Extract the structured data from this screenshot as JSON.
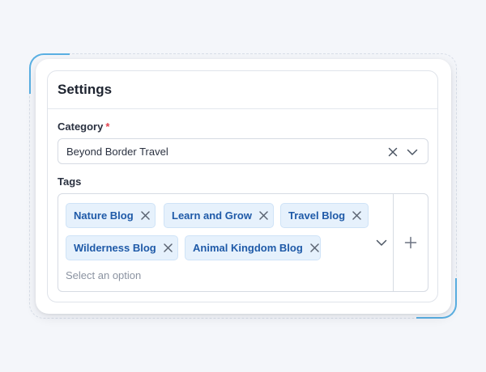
{
  "settings": {
    "title": "Settings",
    "category": {
      "label": "Category",
      "required_mark": "*",
      "value": "Beyond Border Travel"
    },
    "tags": {
      "label": "Tags",
      "items": [
        {
          "label": "Nature Blog"
        },
        {
          "label": "Learn and Grow"
        },
        {
          "label": "Travel Blog"
        },
        {
          "label": "Wilderness Blog"
        },
        {
          "label": "Animal Kingdom Blog"
        }
      ],
      "placeholder": "Select an option"
    }
  },
  "icons": {
    "clear": "close-icon",
    "dropdown": "chevron-down-icon",
    "add": "plus-icon",
    "remove_tag": "close-icon"
  },
  "colors": {
    "accent": "#5ab0e3",
    "required": "#e1434f",
    "tag_background": "#e6f1fc",
    "tag_text": "#1f5aa8"
  }
}
